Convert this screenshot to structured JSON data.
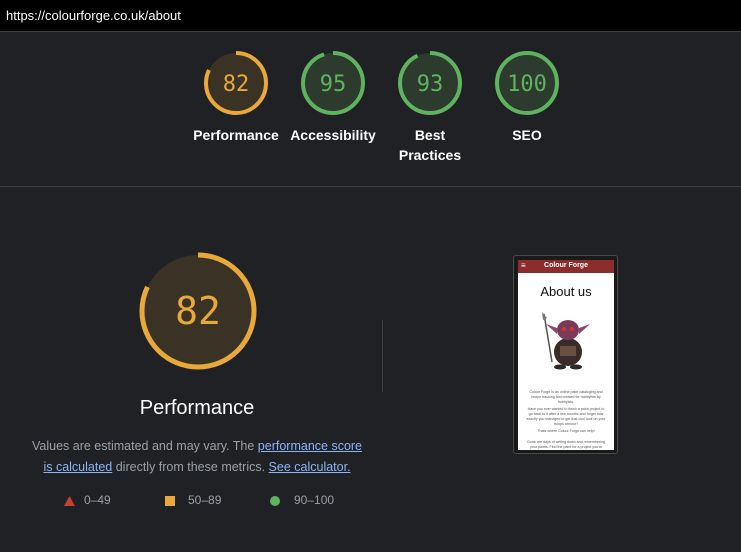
{
  "url": "https://colourforge.co.uk/about",
  "colors": {
    "average": "#e8a93a",
    "pass": "#5fb35f",
    "fail": "#c7402d",
    "average_bg": "#3a3325",
    "pass_bg": "#2d3a2e"
  },
  "categories": [
    {
      "score": "82",
      "label": "Performance",
      "rating": "average"
    },
    {
      "score": "95",
      "label": "Accessibility",
      "rating": "pass"
    },
    {
      "score": "93",
      "label": "Best Practices",
      "rating": "pass"
    },
    {
      "score": "100",
      "label": "SEO",
      "rating": "pass"
    }
  ],
  "main": {
    "score": "82",
    "title": "Performance",
    "desc_prefix": "Values are estimated and may vary. The ",
    "desc_link1": "performance score is calculated",
    "desc_middle": " directly from these metrics. ",
    "desc_link2": "See calculator."
  },
  "legend": [
    {
      "range": "0–49",
      "shape": "triangle-icon"
    },
    {
      "range": "50–89",
      "shape": "square-icon"
    },
    {
      "range": "90–100",
      "shape": "circle-icon"
    }
  ],
  "screenshot": {
    "brand": "Colour Forge",
    "menu_glyph": "≡",
    "title": "About us",
    "paragraphs": [
      "Colour Forge is an online paint cataloging and recipe tracking tool created for hobbyists by hobbyists.",
      "Have you ever wanted to finish a paint project to go back to it after a few months and forget how exactly you managed to get that cool look on your troops armour?",
      "Thats where Colour Forge can help!",
      "Gone are days of writing down and remembering your paints. Find the paint for a project you're working on."
    ]
  }
}
